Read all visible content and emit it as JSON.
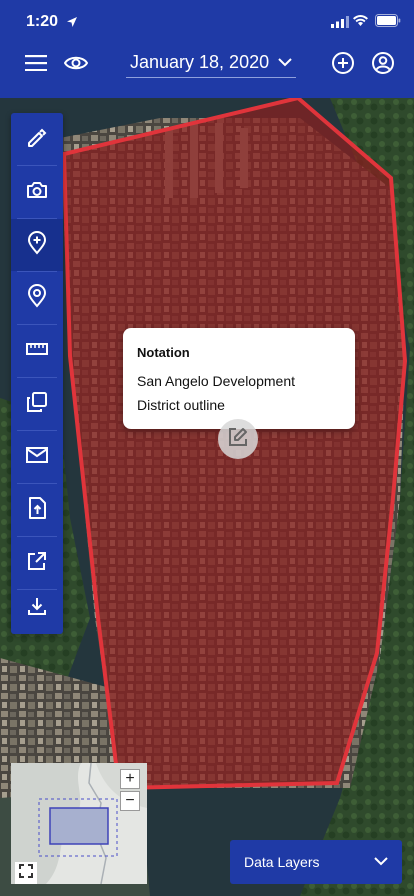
{
  "status_bar": {
    "time": "1:20"
  },
  "header": {
    "date_selected": "January 18, 2020",
    "icons": [
      "menu-icon",
      "eye-icon",
      "chevron-down-icon",
      "add-circle-icon",
      "account-circle-icon"
    ]
  },
  "side_toolbar": {
    "tools": [
      {
        "name": "edit",
        "icon": "edit-icon"
      },
      {
        "name": "camera",
        "icon": "camera-icon"
      },
      {
        "name": "add-location",
        "icon": "add-location-icon",
        "active": true
      },
      {
        "name": "location",
        "icon": "location-pin-icon"
      },
      {
        "name": "measure",
        "icon": "ruler-icon"
      },
      {
        "name": "copy",
        "icon": "copy-icon"
      },
      {
        "name": "mail",
        "icon": "mail-icon"
      },
      {
        "name": "upload",
        "icon": "upload-file-icon"
      },
      {
        "name": "share",
        "icon": "external-link-icon"
      },
      {
        "name": "download",
        "icon": "download-icon"
      }
    ]
  },
  "popup": {
    "title": "Notation",
    "line1": "San Angelo Development",
    "line2": "District outline"
  },
  "minimap": {
    "zoom_in": "+",
    "zoom_out": "−"
  },
  "data_layers": {
    "label": "Data Layers"
  },
  "colors": {
    "primary": "#1f3aa6",
    "primary_active": "#17308e",
    "district_fill": "#8a1f1f",
    "district_stroke": "#e0343b"
  }
}
